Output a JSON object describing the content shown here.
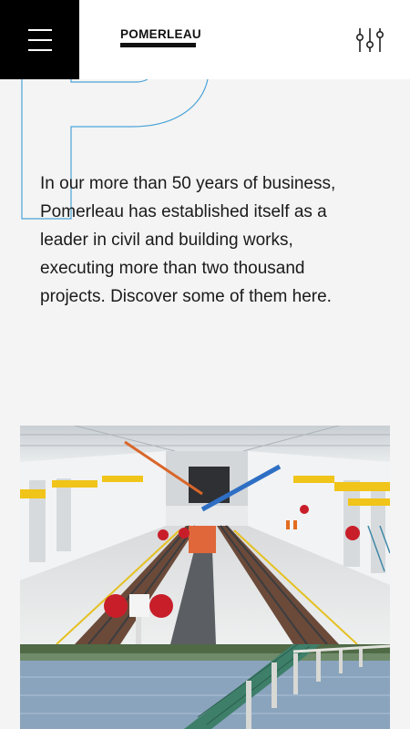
{
  "header": {
    "logo_text": "POMERLEAU",
    "menu_icon": "hamburger-icon",
    "filter_icon": "sliders-filter-icon"
  },
  "intro": {
    "text": "In our more than 50 years of business, Pomerleau has established itself as a leader in civil and building works, executing more than two thousand projects. Discover some of them here."
  },
  "colors": {
    "background": "#f4f4f4",
    "header": "#ffffff",
    "menu_button": "#000000",
    "outline_letter": "#4aa3d8"
  }
}
